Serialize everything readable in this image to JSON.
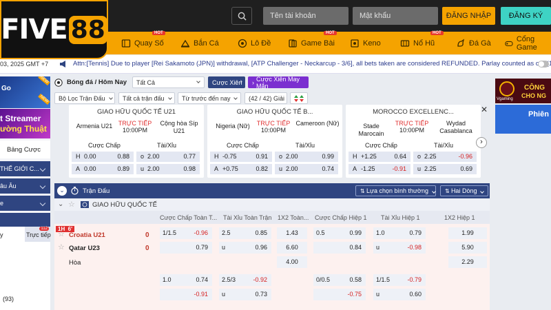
{
  "logo": {
    "text1": "FIVE",
    "text2": "88"
  },
  "header": {
    "username_placeholder": "Tên tài khoản",
    "password_placeholder": "Mật khẩu",
    "login": "ĐĂNG NHẬP",
    "register": "ĐĂNG KÝ"
  },
  "nav": {
    "items": [
      {
        "label": "Quay Số",
        "hot": "HOT"
      },
      {
        "label": "Bắn Cá"
      },
      {
        "label": "Lô Đề"
      },
      {
        "label": "Game Bài",
        "hot": "HOT"
      },
      {
        "label": "Keno"
      },
      {
        "label": "Nổ Hũ",
        "hot": "HOT"
      },
      {
        "label": "Đá Gà"
      },
      {
        "label": "Cổng Game"
      }
    ]
  },
  "ticker": {
    "time": "03, 2025 GMT +7",
    "message": "Attn:[Tennis] Due to player [Rei Sakamoto (JPN)] withdrawal, [ATP Challenger - Neckarcup - 3/6], all bets taken are considered REFUNDED. Parlay counted as one(1)."
  },
  "sidebar": {
    "new1": "NEW",
    "frag1": "Go",
    "new2": "NEW",
    "streamer1": "t Streamer",
    "streamer2": "ường Thuật",
    "bang_cuoc": "Bảng Cược",
    "sec1": "THẾ GIỚI C...",
    "sec2": "âu Âu",
    "sec3": "e",
    "tab1": "y",
    "tab2": "Trực tiếp",
    "tab2_count": "112",
    "footer": "(93)"
  },
  "filters": {
    "sport": "Bóng đá / Hôm Nay",
    "day": "Tất Cả",
    "parlay": "Cược Xiên",
    "parlay_random": "Cược Xiên May Mắn",
    "league_filter": "Bộ Lọc Trận Đấu",
    "match_type": "Tất cả trận đấu",
    "sort": "Từ trước đến nay",
    "count": "(42 / 42) Giải"
  },
  "cards": [
    {
      "comp": "GIAO HỮU QUỐC TẾ U21",
      "home": "Armenia U21",
      "away": "Cộng hòa Síp U21",
      "live": "TRỰC TIẾP",
      "time": "10:00PM",
      "handicap_label": "Cược Chấp",
      "ou_label": "Tài/Xỉu",
      "rows": [
        {
          "l": "H",
          "hc": "0.00",
          "ho": "0.88",
          "ol": "o",
          "ou": "2.00",
          "oo": "0.77",
          "hneg": false,
          "oneg": false
        },
        {
          "l": "A",
          "hc": "0.00",
          "ho": "0.89",
          "ol": "u",
          "ou": "2.00",
          "oo": "0.98",
          "hneg": false,
          "oneg": false
        }
      ]
    },
    {
      "comp": "GIAO HỮU QUỐC TẾ B...",
      "home": "Nigeria (Nữ)",
      "away": "Cameroon (Nữ)",
      "live": "TRỰC TIẾP",
      "time": "10:00PM",
      "handicap_label": "Cược Chấp",
      "ou_label": "Tài/Xỉu",
      "rows": [
        {
          "l": "H",
          "hc": "-0.75",
          "ho": "0.91",
          "ol": "o",
          "ou": "2.00",
          "oo": "0.99",
          "hneg": false,
          "oneg": false
        },
        {
          "l": "A",
          "hc": "+0.75",
          "ho": "0.82",
          "ol": "u",
          "ou": "2.00",
          "oo": "0.74",
          "hneg": false,
          "oneg": false
        }
      ]
    },
    {
      "comp": "MOROCCO EXCELLENC...",
      "home": "Stade Marocain",
      "away": "Wydad Casablanca",
      "live": "TRỰC TIẾP",
      "time": "10:00PM",
      "handicap_label": "Cược Chấp",
      "ou_label": "Tài/Xỉu",
      "rows": [
        {
          "l": "H",
          "hc": "+1.25",
          "ho": "0.64",
          "ol": "o",
          "ou": "2.25",
          "oo": "-0.96",
          "hneg": false,
          "oneg": true
        },
        {
          "l": "A",
          "hc": "-1.25",
          "ho": "-0.91",
          "ol": "u",
          "ou": "2.25",
          "oo": "0.69",
          "hneg": true,
          "oneg": false
        }
      ]
    }
  ],
  "table": {
    "title": "Trận Đấu",
    "view_select": "Lựa chọn bình thường",
    "odds_type": "Hai Dòng",
    "competition": "GIAO HỮU QUỐC TẾ",
    "columns": [
      "Cược Chấp Toàn T...",
      "Tài Xỉu Toàn Trận",
      "1X2 Toàn...",
      "Cược Chấp Hiệp 1",
      "Tài Xỉu Hiệp 1",
      "1X2 Hiệp 1"
    ],
    "match": {
      "period": "1H  6'",
      "home": "Croatia U21",
      "away": "Qatar U23",
      "home_score": "0",
      "away_score": "0",
      "draw": "Hòa"
    },
    "row1": {
      "c1a": "1/1.5",
      "c1b": "-0.96",
      "c2a": "2.5",
      "c2b": "0.85",
      "c3": "1.43",
      "c4a": "0.5",
      "c4b": "0.99",
      "c5a": "1.0",
      "c5b": "0.79",
      "c6": "1.99"
    },
    "row2": {
      "c1b": "0.79",
      "c2a": "u",
      "c2b": "0.96",
      "c3": "6.60",
      "c4b": "0.84",
      "c5a": "u",
      "c5b": "-0.98",
      "c6": "5.90"
    },
    "row3": {
      "c3": "4.00",
      "c6": "2.29"
    },
    "row4": {
      "c1a": "1.0",
      "c1b": "0.74",
      "c2a": "2.5/3",
      "c2b": "-0.92",
      "c4a": "0/0.5",
      "c4b": "0.58",
      "c5a": "1/1.5",
      "c5b": "-0.79"
    },
    "row5": {
      "c1b": "-0.91",
      "c2a": "u",
      "c2b": "0.73",
      "c4b": "-0.75",
      "c5a": "u",
      "c5b": "0.60"
    }
  },
  "banners": {
    "b1_brand": "Vgaming",
    "b1_text1": "CÔNG",
    "b1_text2": "CHO NG",
    "b2_text": "Phiên"
  },
  "colors": {
    "accent": "#f5a300",
    "navy": "#2f4581",
    "negative": "#d61f1f",
    "live": "#e03030"
  }
}
